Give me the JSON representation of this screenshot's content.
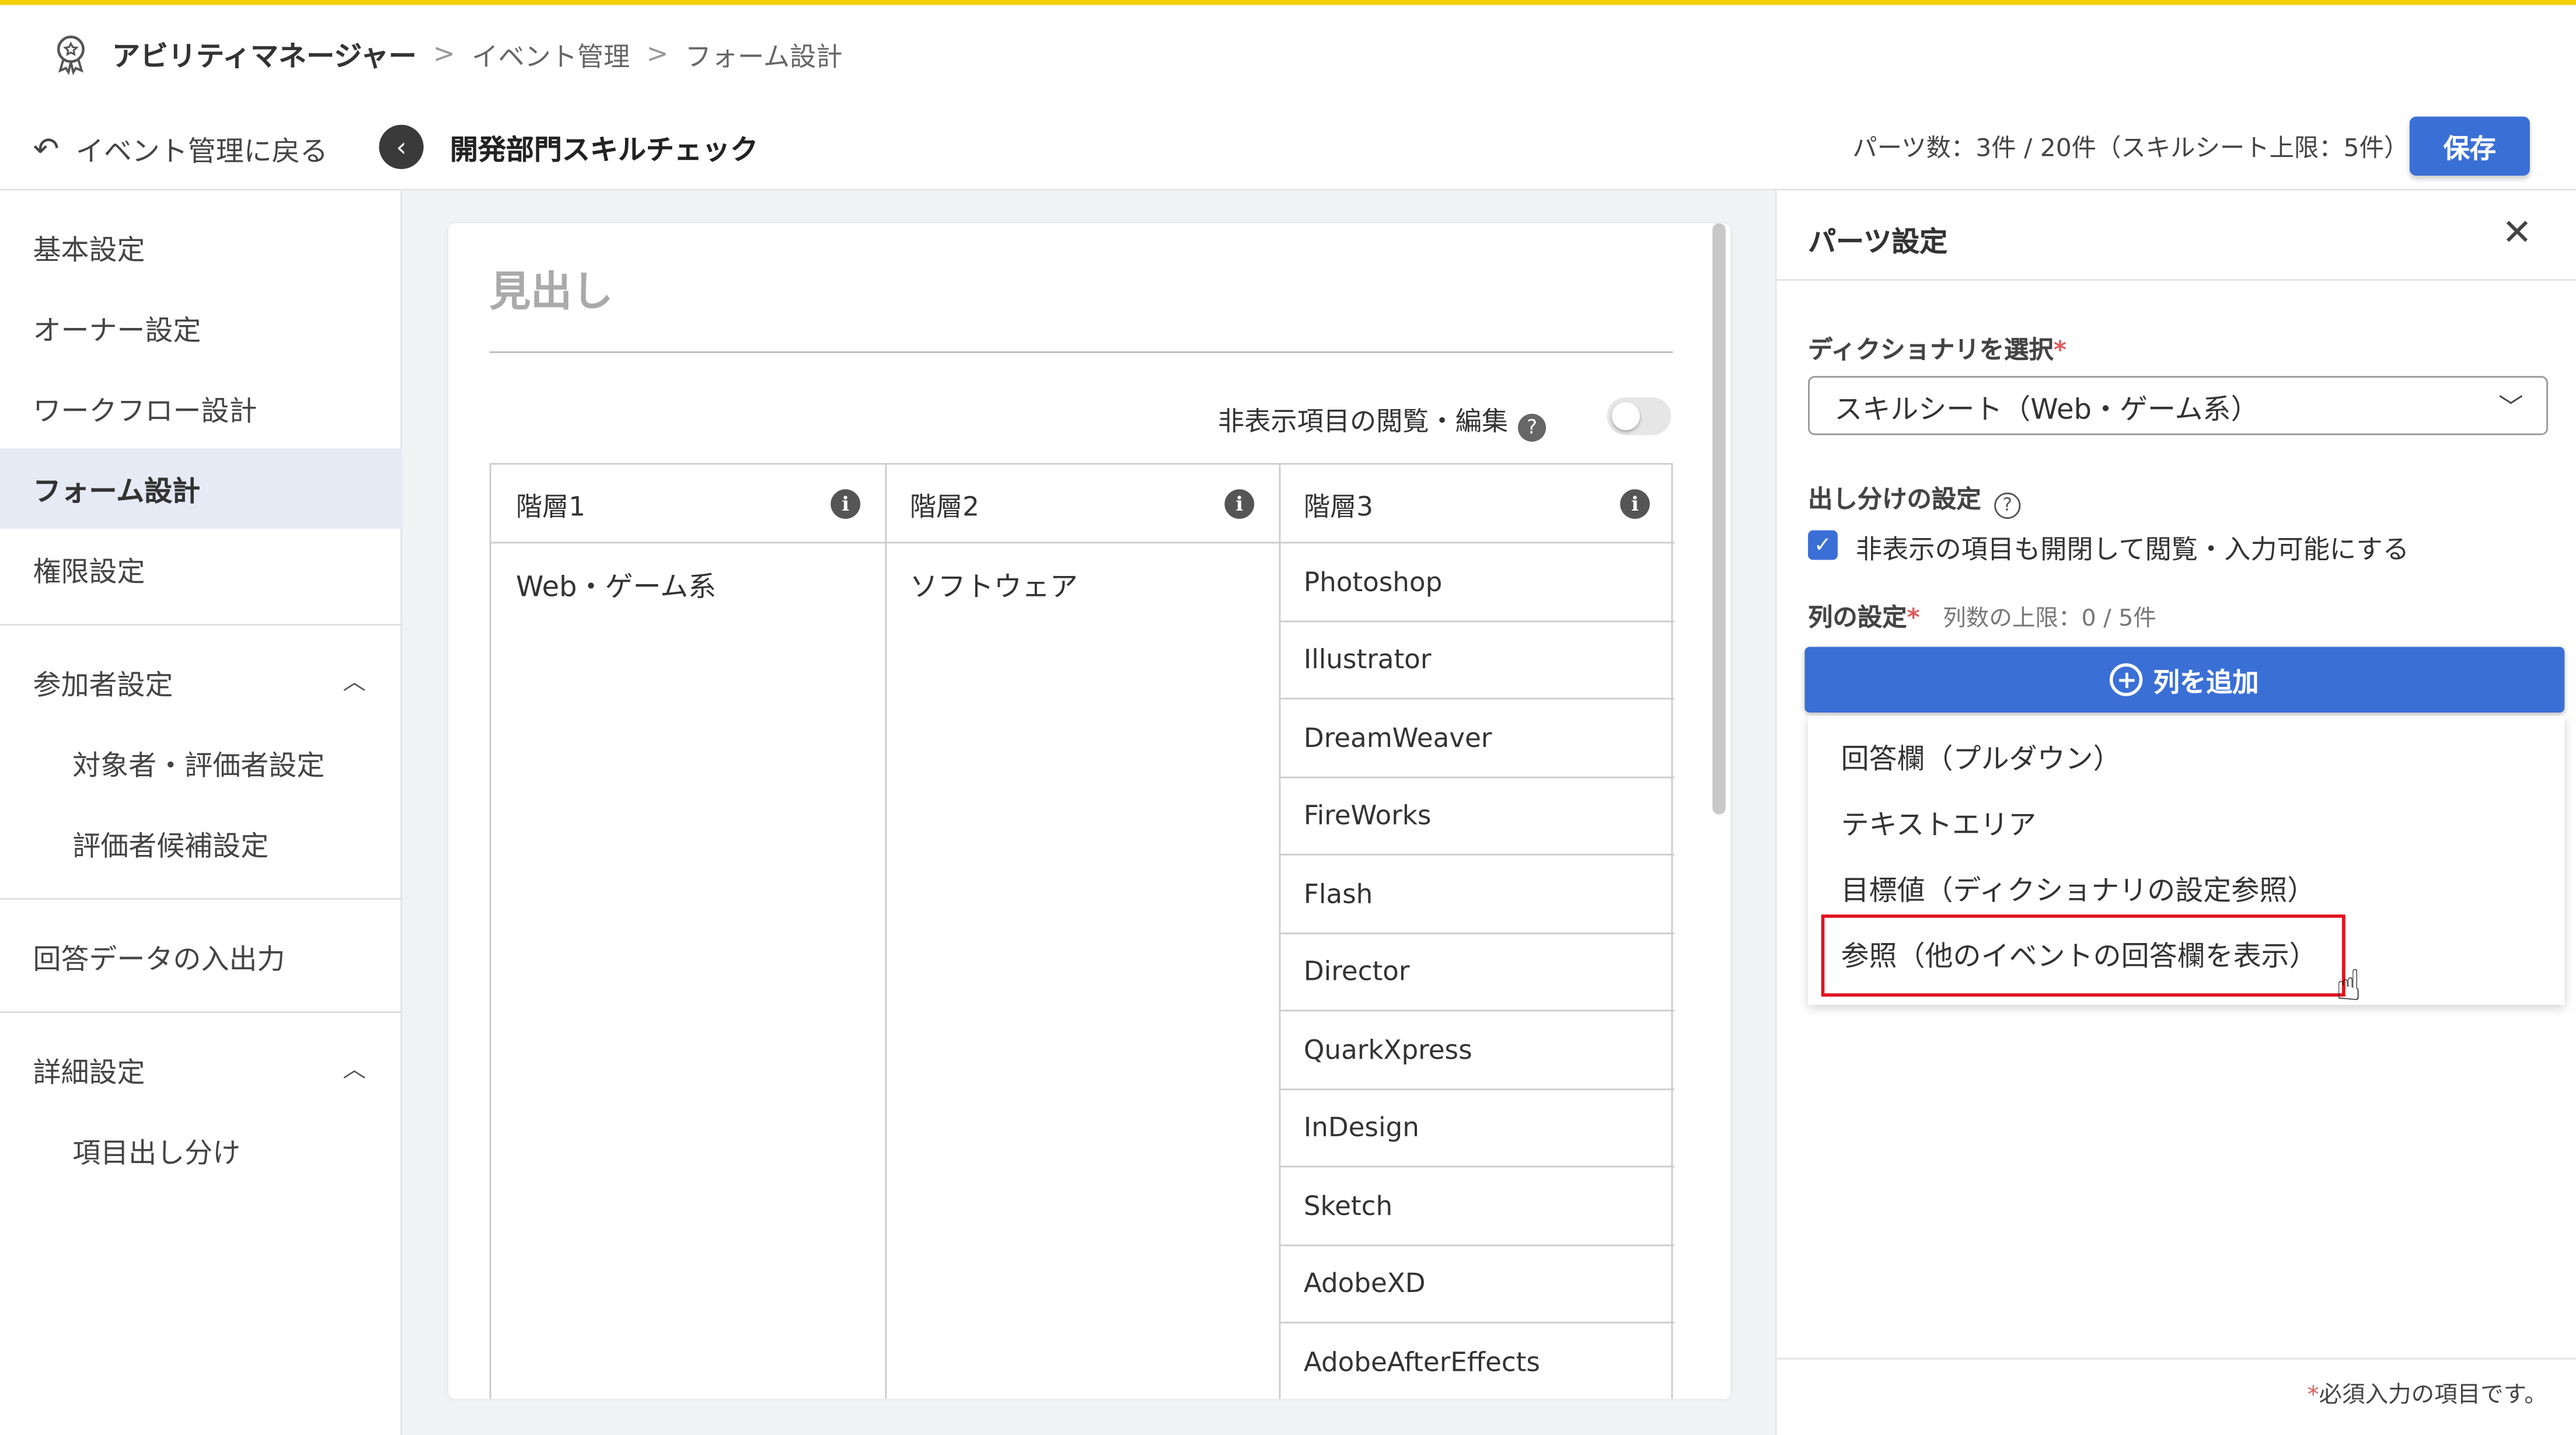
{
  "header": {
    "app_name": "アビリティマネージャー",
    "breadcrumb": [
      "イベント管理",
      "フォーム設計"
    ],
    "sep": ">"
  },
  "subheader": {
    "back_label": "イベント管理に戻る",
    "event_title": "開発部門スキルチェック",
    "parts_count": "パーツ数：3件 / 20件（スキルシート上限：5件）",
    "save_label": "保存"
  },
  "sidebar": {
    "items": [
      {
        "label": "基本設定"
      },
      {
        "label": "オーナー設定"
      },
      {
        "label": "ワークフロー設計"
      },
      {
        "label": "フォーム設計",
        "active": true
      },
      {
        "label": "権限設定"
      }
    ],
    "participants": {
      "label": "参加者設定",
      "children": [
        "対象者・評価者設定",
        "評価者候補設定"
      ]
    },
    "io_label": "回答データの入出力",
    "advanced": {
      "label": "詳細設定",
      "children": [
        "項目出し分け"
      ]
    }
  },
  "main": {
    "heading": "見出し",
    "toggle_label": "非表示項目の閲覧・編集",
    "columns": [
      "階層1",
      "階層2",
      "階層3"
    ],
    "level1_value": "Web・ゲーム系",
    "level2_value": "ソフトウェア",
    "level3_values": [
      "Photoshop",
      "Illustrator",
      "DreamWeaver",
      "FireWorks",
      "Flash",
      "Director",
      "QuarkXpress",
      "InDesign",
      "Sketch",
      "AdobeXD",
      "AdobeAfterEffects"
    ]
  },
  "panel": {
    "title": "パーツ設定",
    "dict_label": "ディクショナリを選択",
    "dict_value": "スキルシート（Web・ゲーム系）",
    "visibility_label": "出し分けの設定",
    "visibility_checkbox_label": "非表示の項目も開閉して閲覧・入力可能にする",
    "col_settings_label": "列の設定",
    "col_limit": "列数の上限：0 / 5件",
    "add_col_label": "列を追加",
    "dropdown_options": [
      "回答欄（プルダウン）",
      "テキストエリア",
      "目標値（ディクショナリの設定参照）",
      "参照（他のイベントの回答欄を表示）"
    ],
    "required_note": "必須入力の項目です。",
    "required_mark": "*"
  },
  "colors": {
    "accent": "#3a6fd6",
    "top_border": "#f5d000",
    "highlight": "#e0141e"
  }
}
